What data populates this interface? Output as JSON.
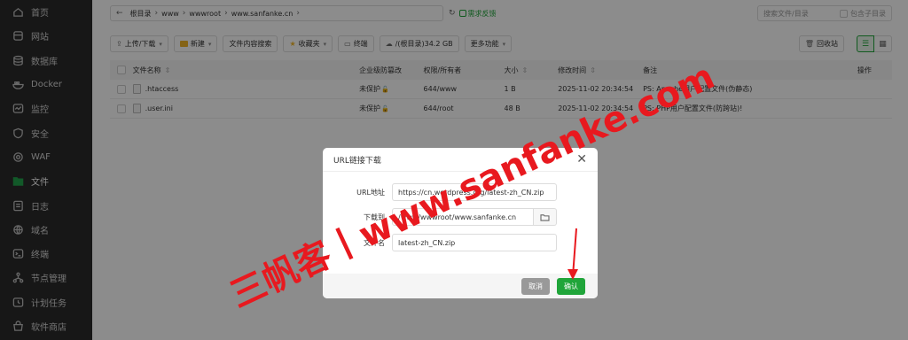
{
  "sidebar": {
    "items": [
      {
        "label": "首页",
        "icon": "home-icon"
      },
      {
        "label": "网站",
        "icon": "globe-icon"
      },
      {
        "label": "数据库",
        "icon": "database-icon"
      },
      {
        "label": "Docker",
        "icon": "docker-icon"
      },
      {
        "label": "监控",
        "icon": "monitor-icon"
      },
      {
        "label": "安全",
        "icon": "shield-icon"
      },
      {
        "label": "WAF",
        "icon": "waf-icon"
      },
      {
        "label": "文件",
        "icon": "folder-icon"
      },
      {
        "label": "日志",
        "icon": "log-icon"
      },
      {
        "label": "域名",
        "icon": "domain-icon"
      },
      {
        "label": "终端",
        "icon": "terminal-icon"
      },
      {
        "label": "节点管理",
        "icon": "node-icon"
      },
      {
        "label": "计划任务",
        "icon": "clock-icon"
      },
      {
        "label": "软件商店",
        "icon": "store-icon"
      }
    ],
    "active_index": 7,
    "accent": "#21a34b"
  },
  "topbar": {
    "path": [
      "根目录",
      "www",
      "wwwroot",
      "www.sanfanke.cn"
    ],
    "feedback": "需求反馈",
    "search_placeholder": "搜索文件/目录",
    "include_subdir": "包含子目录"
  },
  "toolbar": {
    "upload": "上传/下载",
    "new": "新建",
    "search_content": "文件内容搜索",
    "favorites": "收藏夹",
    "terminal": "终端",
    "disk": "/(根目录)34.2 GB",
    "more": "更多功能",
    "recycle": "回收站"
  },
  "table": {
    "headers": {
      "name": "文件名称",
      "protect": "企业级防篡改",
      "perm": "权限/所有者",
      "size": "大小",
      "mtime": "修改时间",
      "note": "备注",
      "op": "操作"
    },
    "rows": [
      {
        "name": ".htaccess",
        "protect": "未保护",
        "perm": "644/www",
        "size": "1 B",
        "mtime": "2025-11-02 20:34:54",
        "note": "PS: Apache用户配置文件(伪静态)"
      },
      {
        "name": ".user.ini",
        "protect": "未保护",
        "perm": "644/root",
        "size": "48 B",
        "mtime": "2025-11-02 20:34:54",
        "note": "PS: PHP用户配置文件(防跨站)!"
      }
    ]
  },
  "dialog": {
    "title": "URL链接下载",
    "url_label": "URL地址",
    "url_value": "https://cn.wordpress.org/latest-zh_CN.zip",
    "dir_label": "下载到",
    "dir_value": "/www/wwwroot/www.sanfanke.cn",
    "filename_label": "文件名",
    "filename_value": "latest-zh_CN.zip",
    "cancel": "取消",
    "confirm": "确认"
  },
  "watermark": {
    "text": "三帆客丨www.sanfanke.com",
    "color": "#e8191f"
  }
}
